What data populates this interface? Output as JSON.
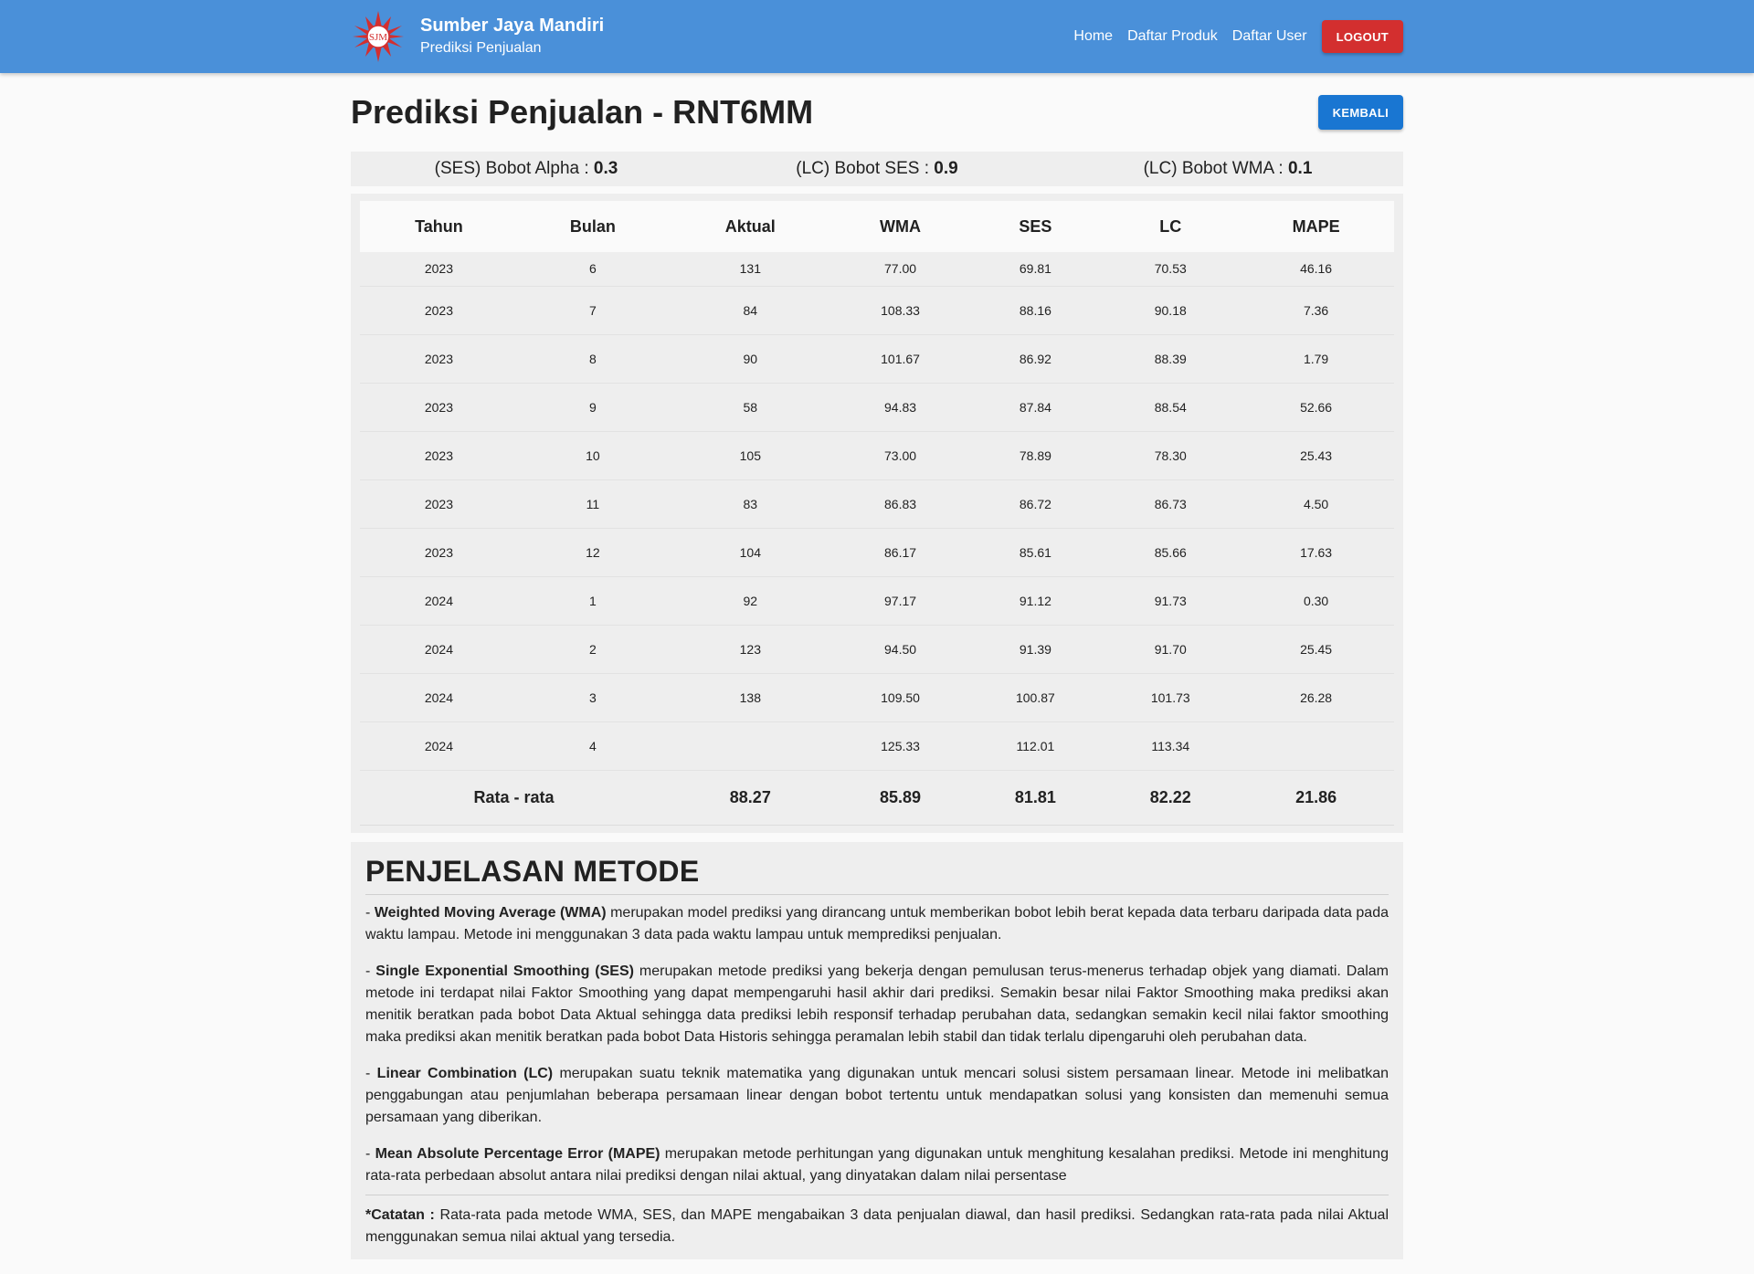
{
  "header": {
    "brand_title": "Sumber Jaya Mandiri",
    "brand_subtitle": "Prediksi Penjualan",
    "logo_text": "SJM",
    "nav": [
      "Home",
      "Daftar Produk",
      "Daftar User"
    ],
    "logout_label": "LOGOUT"
  },
  "page": {
    "title": "Prediksi Penjualan - RNT6MM",
    "back_label": "KEMBALI"
  },
  "params": [
    {
      "label": "(SES) Bobot Alpha : ",
      "value": "0.3"
    },
    {
      "label": "(LC) Bobot SES : ",
      "value": "0.9"
    },
    {
      "label": "(LC) Bobot WMA : ",
      "value": "0.1"
    }
  ],
  "table": {
    "columns": [
      "Tahun",
      "Bulan",
      "Aktual",
      "WMA",
      "SES",
      "LC",
      "MAPE"
    ],
    "rows": [
      [
        "2023",
        "6",
        "131",
        "77.00",
        "69.81",
        "70.53",
        "46.16"
      ],
      [
        "2023",
        "7",
        "84",
        "108.33",
        "88.16",
        "90.18",
        "7.36"
      ],
      [
        "2023",
        "8",
        "90",
        "101.67",
        "86.92",
        "88.39",
        "1.79"
      ],
      [
        "2023",
        "9",
        "58",
        "94.83",
        "87.84",
        "88.54",
        "52.66"
      ],
      [
        "2023",
        "10",
        "105",
        "73.00",
        "78.89",
        "78.30",
        "25.43"
      ],
      [
        "2023",
        "11",
        "83",
        "86.83",
        "86.72",
        "86.73",
        "4.50"
      ],
      [
        "2023",
        "12",
        "104",
        "86.17",
        "85.61",
        "85.66",
        "17.63"
      ],
      [
        "2024",
        "1",
        "92",
        "97.17",
        "91.12",
        "91.73",
        "0.30"
      ],
      [
        "2024",
        "2",
        "123",
        "94.50",
        "91.39",
        "91.70",
        "25.45"
      ],
      [
        "2024",
        "3",
        "138",
        "109.50",
        "100.87",
        "101.73",
        "26.28"
      ],
      [
        "2024",
        "4",
        "",
        "125.33",
        "112.01",
        "113.34",
        ""
      ]
    ],
    "footer": {
      "label": "Rata - rata",
      "aktual": "88.27",
      "wma": "85.89",
      "ses": "81.81",
      "lc": "82.22",
      "mape": "21.86"
    }
  },
  "method": {
    "title": "PENJELASAN METODE",
    "items": [
      {
        "prefix": "- ",
        "term": "Weighted Moving Average (WMA)",
        "text": " merupakan model prediksi yang dirancang untuk memberikan bobot lebih berat kepada data terbaru daripada data pada waktu lampau. Metode ini menggunakan 3 data pada waktu lampau untuk memprediksi penjualan."
      },
      {
        "prefix": "- ",
        "term": "Single Exponential Smoothing (SES)",
        "text": " merupakan metode prediksi yang bekerja dengan pemulusan terus-menerus terhadap objek yang diamati. Dalam metode ini terdapat nilai Faktor Smoothing yang dapat mempengaruhi hasil akhir dari prediksi. Semakin besar nilai Faktor Smoothing maka prediksi akan menitik beratkan pada bobot Data Aktual sehingga data prediksi lebih responsif terhadap perubahan data, sedangkan semakin kecil nilai faktor smoothing maka prediksi akan menitik beratkan pada bobot Data Historis sehingga peramalan lebih stabil dan tidak terlalu dipengaruhi oleh perubahan data."
      },
      {
        "prefix": "- ",
        "term": "Linear Combination (LC)",
        "text": " merupakan suatu teknik matematika yang digunakan untuk mencari solusi sistem persamaan linear. Metode ini melibatkan penggabungan atau penjumlahan beberapa persamaan linear dengan bobot tertentu untuk mendapatkan solusi yang konsisten dan memenuhi semua persamaan yang diberikan."
      },
      {
        "prefix": "- ",
        "term": "Mean Absolute Percentage Error (MAPE)",
        "text": " merupakan metode perhitungan yang digunakan untuk menghitung kesalahan prediksi. Metode ini menghitung rata-rata perbedaan absolut antara nilai prediksi dengan nilai aktual, yang dinyatakan dalam nilai persentase"
      }
    ],
    "note_term": "*Catatan :",
    "note_text": " Rata-rata pada metode WMA, SES, dan MAPE mengabaikan 3 data penjualan diawal, dan hasil prediksi. Sedangkan rata-rata pada nilai Aktual menggunakan semua nilai aktual yang tersedia."
  },
  "colors": {
    "navbar": "#4a90d9",
    "logout": "#d32f2f",
    "back": "#1976d2",
    "logo_red": "#d32f2f"
  }
}
